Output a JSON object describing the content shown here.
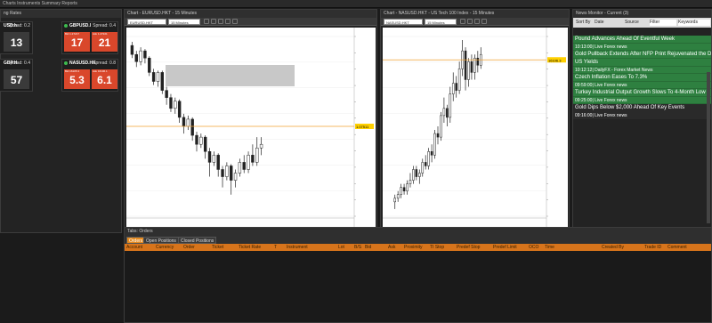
{
  "menubar": "Charts  Instruments  Summary  Reports",
  "rates": {
    "title": "ng Rates",
    "cards": [
      {
        "symbol": "USD.h",
        "spread": "Spread: 0.2",
        "bid": "",
        "ask": "13",
        "ask_small": "",
        "bid_small": "",
        "color": "dark"
      },
      {
        "symbol": "GBPUSD.I",
        "spread": "Spread: 0.4",
        "bid": "17",
        "ask": "21",
        "bid_small": "Bid 1.27217",
        "ask_small": "Ask 1.27221",
        "color": "red"
      },
      {
        "symbol": "GBP.H",
        "spread": "Spread: 0.4",
        "bid": "",
        "ask": "57",
        "bid_small": "",
        "ask_small": "",
        "color": "dark"
      },
      {
        "symbol": "NASUSD.HK",
        "spread": "Spread: 0.8",
        "bid": "5.3",
        "ask": "6.1",
        "bid_small": "Bid 16105.3",
        "ask_small": "Ask 16106.1",
        "color": "red"
      }
    ]
  },
  "chart1": {
    "title": "Chart - EURUSD.HKT - 15 Minutes",
    "symbol": "EURUSD.HKT",
    "timeframe": "15 Minutes",
    "price_marker": "1.07511",
    "candles": [
      [
        0.95,
        0.9,
        0.97,
        0.88
      ],
      [
        0.9,
        0.86,
        0.92,
        0.83
      ],
      [
        0.86,
        0.92,
        0.94,
        0.84
      ],
      [
        0.92,
        0.88,
        0.93,
        0.85
      ],
      [
        0.88,
        0.8,
        0.89,
        0.78
      ],
      [
        0.8,
        0.75,
        0.82,
        0.73
      ],
      [
        0.75,
        0.8,
        0.81,
        0.72
      ],
      [
        0.8,
        0.7,
        0.81,
        0.68
      ],
      [
        0.7,
        0.66,
        0.72,
        0.62
      ],
      [
        0.66,
        0.6,
        0.68,
        0.58
      ],
      [
        0.6,
        0.64,
        0.66,
        0.57
      ],
      [
        0.64,
        0.55,
        0.65,
        0.52
      ],
      [
        0.55,
        0.5,
        0.57,
        0.46
      ],
      [
        0.5,
        0.54,
        0.56,
        0.48
      ],
      [
        0.54,
        0.45,
        0.55,
        0.42
      ],
      [
        0.45,
        0.4,
        0.47,
        0.36
      ],
      [
        0.4,
        0.44,
        0.46,
        0.38
      ],
      [
        0.44,
        0.36,
        0.45,
        0.32
      ],
      [
        0.36,
        0.3,
        0.38,
        0.22
      ],
      [
        0.3,
        0.34,
        0.36,
        0.28
      ],
      [
        0.34,
        0.26,
        0.35,
        0.22
      ],
      [
        0.26,
        0.22,
        0.28,
        0.16
      ],
      [
        0.22,
        0.28,
        0.3,
        0.2
      ],
      [
        0.28,
        0.2,
        0.29,
        0.12
      ],
      [
        0.2,
        0.24,
        0.26,
        0.16
      ],
      [
        0.24,
        0.3,
        0.32,
        0.22
      ],
      [
        0.3,
        0.26,
        0.34,
        0.24
      ],
      [
        0.26,
        0.34,
        0.36,
        0.24
      ],
      [
        0.34,
        0.3,
        0.4,
        0.28
      ],
      [
        0.3,
        0.38,
        0.44,
        0.28
      ],
      [
        0.38,
        0.4,
        0.44,
        0.34
      ]
    ]
  },
  "chart2": {
    "title": "Chart - NASUSD.HKT - US Tech 100 Index - 15 Minutes",
    "symbol": "NASUSD.HKT",
    "timeframe": "15 Minutes",
    "price_marker": "16106.3",
    "candles": [
      [
        0.08,
        0.1,
        0.12,
        0.04
      ],
      [
        0.1,
        0.12,
        0.14,
        0.08
      ],
      [
        0.12,
        0.16,
        0.18,
        0.1
      ],
      [
        0.16,
        0.14,
        0.18,
        0.12
      ],
      [
        0.14,
        0.18,
        0.2,
        0.12
      ],
      [
        0.18,
        0.2,
        0.24,
        0.16
      ],
      [
        0.2,
        0.26,
        0.28,
        0.18
      ],
      [
        0.26,
        0.22,
        0.28,
        0.2
      ],
      [
        0.22,
        0.24,
        0.26,
        0.18
      ],
      [
        0.24,
        0.3,
        0.32,
        0.22
      ],
      [
        0.3,
        0.28,
        0.34,
        0.26
      ],
      [
        0.28,
        0.36,
        0.38,
        0.26
      ],
      [
        0.36,
        0.34,
        0.4,
        0.3
      ],
      [
        0.34,
        0.46,
        0.48,
        0.32
      ],
      [
        0.46,
        0.44,
        0.5,
        0.4
      ],
      [
        0.44,
        0.56,
        0.58,
        0.42
      ],
      [
        0.56,
        0.6,
        0.66,
        0.52
      ],
      [
        0.6,
        0.55,
        0.62,
        0.5
      ],
      [
        0.55,
        0.68,
        0.72,
        0.52
      ],
      [
        0.68,
        0.74,
        0.8,
        0.64
      ],
      [
        0.74,
        0.7,
        0.78,
        0.66
      ],
      [
        0.7,
        0.82,
        0.86,
        0.68
      ],
      [
        0.82,
        0.92,
        0.98,
        0.78
      ],
      [
        0.92,
        0.76,
        0.94,
        0.7
      ],
      [
        0.76,
        0.86,
        0.88,
        0.72
      ],
      [
        0.86,
        0.8,
        0.9,
        0.76
      ],
      [
        0.8,
        0.88,
        0.9,
        0.76
      ],
      [
        0.88,
        0.84,
        0.92,
        0.8
      ],
      [
        0.84,
        0.9,
        0.94,
        0.82
      ]
    ]
  },
  "news": {
    "title": "News Monitor - Current (3)",
    "toolbar": {
      "sort": "Sort By",
      "date": "Date",
      "source": "Source",
      "filter": "Filter",
      "keywords": "Keywords"
    },
    "items": [
      {
        "headline": "Pound Advances Ahead Of Eventful Week",
        "meta": "10:13:00| Live Forex news"
      },
      {
        "headline": "Gold Pullback Extends After NFP Print Rejuvenated the De",
        "headline2": "US Yields",
        "meta": "10:12:12| DailyFX - Forex Market News"
      },
      {
        "headline": "Czech Inflation Eases To 7.3%",
        "meta": "09:59:00| Live Forex news"
      },
      {
        "headline": "Turkey Industrial Output Growth Slows To 4-Month Low",
        "meta": "09:25:00| Live Forex news"
      },
      {
        "headline": "Gold Dips Below $2,000 Ahead Of Key Events",
        "meta": "09:16:00| Live Forex news"
      }
    ]
  },
  "orders": {
    "title": "Tabs: Orders",
    "tabs": [
      "Orders",
      "Open Positions",
      "Closed Positions"
    ],
    "columns": [
      "Account",
      "Currency",
      "Order",
      "Ticket",
      "Ticket Rate",
      "T",
      "Instrument",
      "Lot",
      "B/S",
      "Bid",
      "Ask",
      "Proximity",
      "TI Stop",
      "Predef Stop",
      "Predef Limit",
      "OCO",
      "Time",
      "Created By",
      "Trade ID",
      "Comment"
    ]
  }
}
